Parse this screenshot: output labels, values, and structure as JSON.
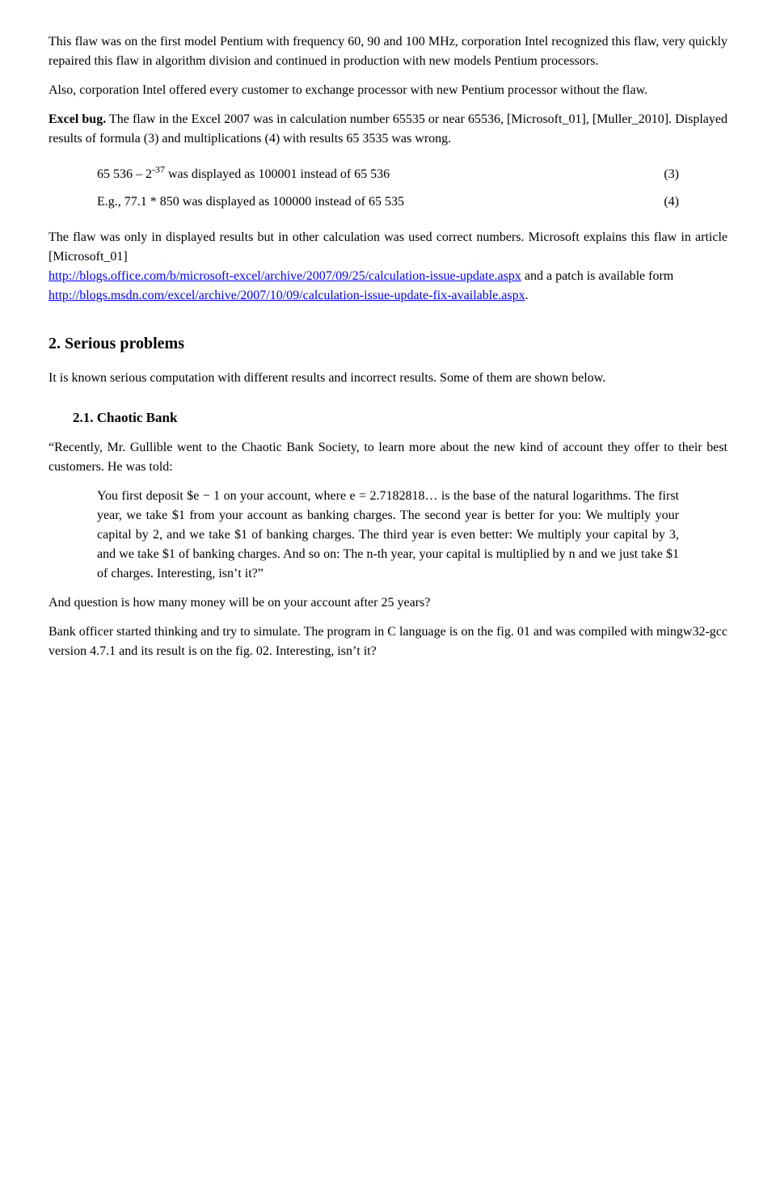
{
  "page": {
    "paragraphs": {
      "intro1": "This flaw was on the first model Pentium with frequency 60, 90 and 100 MHz, corporation Intel recognized this flaw, very quickly repaired this flaw in algorithm division and continued in production with new models Pentium processors.",
      "intro2": "Also, corporation Intel offered every customer to exchange processor with new Pentium processor without the flaw.",
      "excel_bug_label": "Excel bug.",
      "excel_bug_text": " The flaw in the Excel 2007 was in calculation number 65535 or near 65536, [Microsoft_01], [Muller_2010]. Displayed results of formula (3) and multiplications (4) with results 65 3535 was wrong.",
      "formula1_text": "65 536 – 2",
      "formula1_sup": "-37",
      "formula1_rest": " was displayed as 100001 instead of 65 536",
      "formula1_num": "(3)",
      "formula2_text": "E.g., 77.1 * 850 was displayed as 100000 instead of 65 535",
      "formula2_num": "(4)",
      "flaw_explanation": "The flaw was only in displayed results but in other calculation was used correct numbers. Microsoft explains this flaw in article [Microsoft_01]",
      "link1": "http://blogs.office.com/b/microsoft-excel/archive/2007/09/25/calculation-issue-update.aspx",
      "link1_after": " and a patch is available form",
      "link2": "http://blogs.msdn.com/excel/archive/2007/10/09/calculation-issue-update-fix-available.aspx",
      "link2_after": ".",
      "section2_heading": "2.  Serious problems",
      "section2_intro": "It is known serious computation with different results and incorrect results. Some of them are shown below.",
      "subsection21_heading": "2.1.   Chaotic Bank",
      "chaotic_para1": "“Recently, Mr. Gullible went to the Chaotic Bank Society, to learn more about the new kind of account they offer to their best customers. He was told:",
      "indented_para": "You first deposit $e − 1 on your account, where e = 2.7182818… is the base of the natural logarithms. The first year, we take $1 from your account as banking charges. The second year is better for you: We multiply your capital by 2, and we take $1 of banking charges. The third year is even better: We multiply your capital by 3, and we take $1 of banking charges. And so on: The n-th year, your capital is multiplied by n and we just take $1 of charges. Interesting, isnʼt it?”",
      "chaotic_para2": "And question is how many money will be on your account after 25 years?",
      "chaotic_para3": "Bank officer started thinking and try to simulate. The program in C language is on the fig. 01 and was compiled with mingw32-gcc version 4.7.1 and its result is on the fig. 02. Interesting, isnʼt it?"
    }
  }
}
